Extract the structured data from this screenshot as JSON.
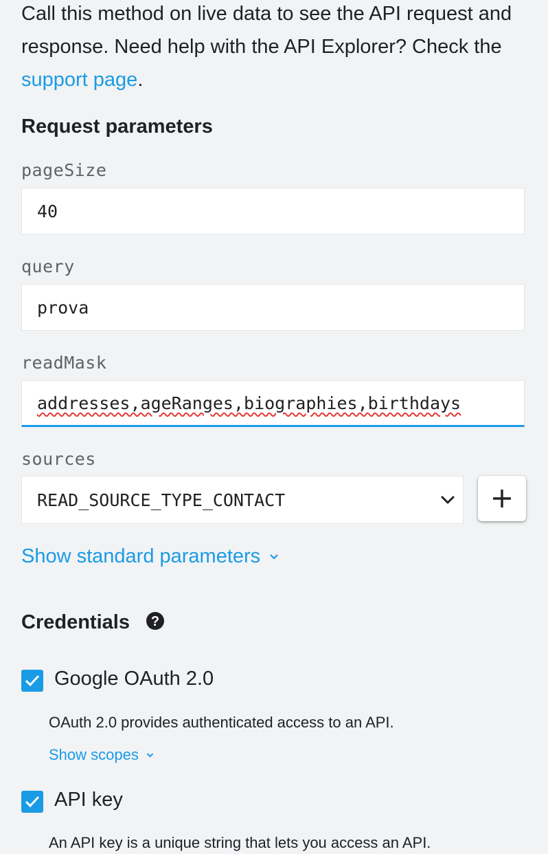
{
  "intro": {
    "text_before_link": "Call this method on live data to see the API request and response. Need help with the API Explorer? Check the ",
    "link_text": "support page",
    "text_after_link": "."
  },
  "request_parameters": {
    "title": "Request parameters",
    "params": [
      {
        "label": "pageSize",
        "value": "40"
      },
      {
        "label": "query",
        "value": "prova"
      },
      {
        "label": "readMask",
        "value": "addresses,ageRanges,biographies,birthdays"
      }
    ],
    "sources": {
      "label": "sources",
      "selected": "READ_SOURCE_TYPE_CONTACT",
      "add_icon": "plus-icon"
    },
    "show_standard_link": "Show standard parameters"
  },
  "credentials": {
    "title": "Credentials",
    "help_icon": "help-circle-icon",
    "items": [
      {
        "label": "Google OAuth 2.0",
        "checked": true,
        "description": "OAuth 2.0 provides authenticated access to an API.",
        "link": "Show scopes"
      },
      {
        "label": "API key",
        "checked": true,
        "description": "An API key is a unique string that lets you access an API."
      }
    ]
  },
  "colors": {
    "accent": "#1a9be6",
    "background": "#f1f3f4",
    "text": "#202124",
    "label": "#5f6368"
  }
}
